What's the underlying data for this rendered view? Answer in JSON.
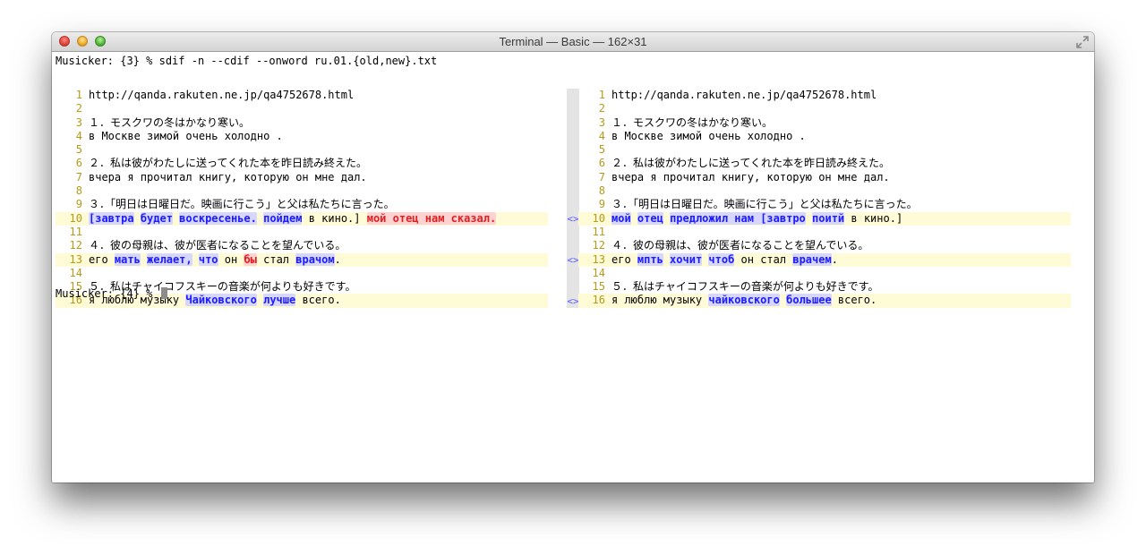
{
  "window": {
    "title": "Terminal — Basic — 162×31"
  },
  "command": {
    "prompt": "Musicker: {3} % ",
    "text": "sdif -n --cdif --onword ru.01.{old,new}.txt"
  },
  "final_prompt": "Musicker: {4} % ",
  "diff_marker": "<>",
  "left": [
    {
      "n": "1",
      "segs": [
        {
          "t": "http://qanda.rakuten.ne.jp/qa4752678.html"
        }
      ]
    },
    {
      "n": "2",
      "segs": []
    },
    {
      "n": "3",
      "segs": [
        {
          "t": "１．モスクワの冬はかなり寒い。"
        }
      ]
    },
    {
      "n": "4",
      "segs": [
        {
          "t": "в Москве зимой очень холодно ."
        }
      ]
    },
    {
      "n": "5",
      "segs": []
    },
    {
      "n": "6",
      "segs": [
        {
          "t": "２．私は彼がわたしに送ってくれた本を昨日読み終えた。"
        }
      ]
    },
    {
      "n": "7",
      "segs": [
        {
          "t": "вчера я прочитал книгу, которую он мне дал."
        }
      ]
    },
    {
      "n": "8",
      "segs": []
    },
    {
      "n": "9",
      "segs": [
        {
          "t": "３．「明日は日曜日だ。映画に行こう」と父は私たちに言った。"
        }
      ]
    },
    {
      "n": "10",
      "changed": true,
      "segs": [
        {
          "t": "[завтра",
          "c": "chg"
        },
        {
          "t": " "
        },
        {
          "t": "будет",
          "c": "chg"
        },
        {
          "t": " "
        },
        {
          "t": "воскресенье.",
          "c": "chg"
        },
        {
          "t": " "
        },
        {
          "t": "пойдем",
          "c": "chg"
        },
        {
          "t": " в кино.] "
        },
        {
          "t": "мой отец нам сказал.",
          "c": "del"
        }
      ]
    },
    {
      "n": "11",
      "segs": []
    },
    {
      "n": "12",
      "segs": [
        {
          "t": "４．彼の母親は、彼が医者になることを望んでいる。"
        }
      ]
    },
    {
      "n": "13",
      "changed": true,
      "segs": [
        {
          "t": "его "
        },
        {
          "t": "мать",
          "c": "chg"
        },
        {
          "t": " "
        },
        {
          "t": "желает,",
          "c": "chg"
        },
        {
          "t": " "
        },
        {
          "t": "что",
          "c": "chg"
        },
        {
          "t": " он "
        },
        {
          "t": "бы",
          "c": "del"
        },
        {
          "t": " стал "
        },
        {
          "t": "врачом",
          "c": "chg"
        },
        {
          "t": "."
        }
      ]
    },
    {
      "n": "14",
      "segs": []
    },
    {
      "n": "15",
      "segs": [
        {
          "t": "５．私はチャイコフスキーの音楽が何よりも好きです。"
        }
      ]
    },
    {
      "n": "16",
      "changed": true,
      "segs": [
        {
          "t": "я люблю музыку "
        },
        {
          "t": "Чайковского",
          "c": "chg"
        },
        {
          "t": " "
        },
        {
          "t": "лучше",
          "c": "chg"
        },
        {
          "t": " всего."
        }
      ]
    }
  ],
  "right": [
    {
      "n": "1",
      "segs": [
        {
          "t": "http://qanda.rakuten.ne.jp/qa4752678.html"
        }
      ]
    },
    {
      "n": "2",
      "segs": []
    },
    {
      "n": "3",
      "segs": [
        {
          "t": "１．モスクワの冬はかなり寒い。"
        }
      ]
    },
    {
      "n": "4",
      "segs": [
        {
          "t": "в Москве зимой очень холодно ."
        }
      ]
    },
    {
      "n": "5",
      "segs": []
    },
    {
      "n": "6",
      "segs": [
        {
          "t": "２．私は彼がわたしに送ってくれた本を昨日読み終えた。"
        }
      ]
    },
    {
      "n": "7",
      "segs": [
        {
          "t": "вчера я прочитал книгу, которую он мне дал."
        }
      ]
    },
    {
      "n": "8",
      "segs": []
    },
    {
      "n": "9",
      "segs": [
        {
          "t": "３．「明日は日曜日だ。映画に行こう」と父は私たちに言った。"
        }
      ]
    },
    {
      "n": "10",
      "changed": true,
      "segs": [
        {
          "t": "мой",
          "c": "chg"
        },
        {
          "t": " "
        },
        {
          "t": "отец",
          "c": "chg"
        },
        {
          "t": " "
        },
        {
          "t": "предложил нам [завтро",
          "c": "chg"
        },
        {
          "t": " "
        },
        {
          "t": "поитй",
          "c": "chg"
        },
        {
          "t": " в кино.]"
        }
      ]
    },
    {
      "n": "11",
      "segs": []
    },
    {
      "n": "12",
      "segs": [
        {
          "t": "４．彼の母親は、彼が医者になることを望んでいる。"
        }
      ]
    },
    {
      "n": "13",
      "changed": true,
      "segs": [
        {
          "t": "его "
        },
        {
          "t": "мпть",
          "c": "chg"
        },
        {
          "t": " "
        },
        {
          "t": "хочит",
          "c": "chg"
        },
        {
          "t": " "
        },
        {
          "t": "чтоб",
          "c": "chg"
        },
        {
          "t": " он стал "
        },
        {
          "t": "врачем",
          "c": "chg"
        },
        {
          "t": "."
        }
      ]
    },
    {
      "n": "14",
      "segs": []
    },
    {
      "n": "15",
      "segs": [
        {
          "t": "５．私はチャイコフスキーの音楽が何よりも好きです。"
        }
      ]
    },
    {
      "n": "16",
      "changed": true,
      "segs": [
        {
          "t": "я люблю музыку "
        },
        {
          "t": "чайковского",
          "c": "chg"
        },
        {
          "t": " "
        },
        {
          "t": "большее",
          "c": "chg"
        },
        {
          "t": " всего."
        }
      ]
    }
  ]
}
